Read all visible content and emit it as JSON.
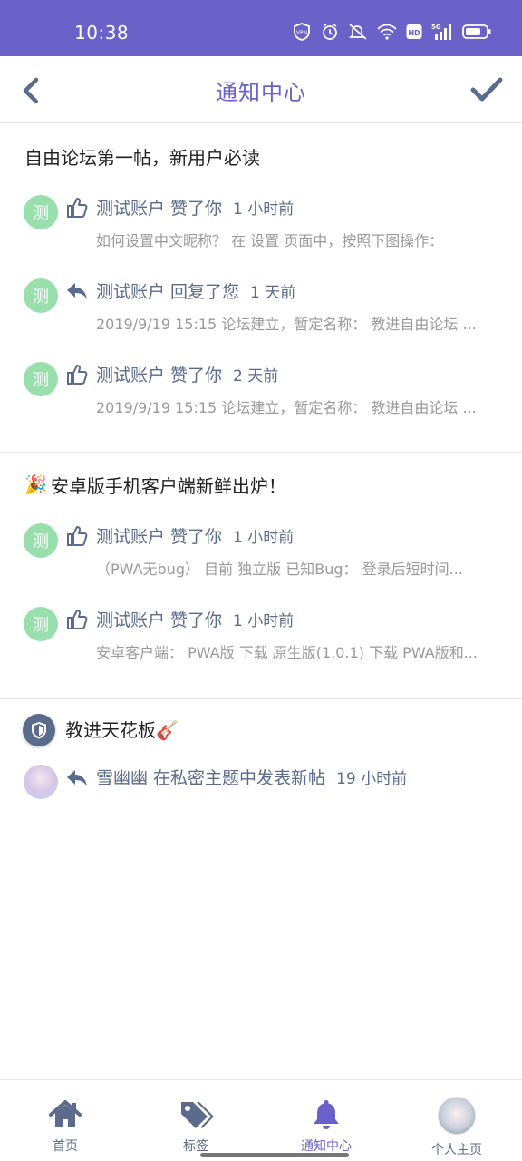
{
  "status_bar": {
    "time": "10:38",
    "icons": [
      "vpn-icon",
      "alarm-icon",
      "mute-icon",
      "wifi-icon",
      "hd-icon",
      "signal-5g-icon",
      "battery-icon"
    ],
    "vpn_text": "VPN",
    "hd_text": "HD",
    "net_text": "5G"
  },
  "header": {
    "title": "通知中心",
    "back_icon": "chevron-left-icon",
    "confirm_icon": "checkmark-icon"
  },
  "groups": [
    {
      "title": "自由论坛第一帖，新用户必读",
      "notifications": [
        {
          "avatar_text": "测",
          "action_icon": "thumbs-up-icon",
          "text": "测试账户 赞了你",
          "time": "1 小时前",
          "excerpt": "如何设置中文昵称？ 在 设置 页面中，按照下图操作："
        },
        {
          "avatar_text": "测",
          "action_icon": "reply-icon",
          "text": "测试账户 回复了您",
          "time": "1 天前",
          "excerpt": "2019/9/19 15:15 论坛建立，暂定名称： 教进自由论坛 ..."
        },
        {
          "avatar_text": "测",
          "action_icon": "thumbs-up-icon",
          "text": "测试账户 赞了你",
          "time": "2 天前",
          "excerpt": "2019/9/19 15:15 论坛建立，暂定名称： 教进自由论坛 ..."
        }
      ]
    },
    {
      "title_emoji": "🎉",
      "title": "安卓版手机客户端新鲜出炉！",
      "notifications": [
        {
          "avatar_text": "测",
          "action_icon": "thumbs-up-icon",
          "text": "测试账户 赞了你",
          "time": "1 小时前",
          "excerpt": "（PWA无bug） 目前 独立版 已知Bug： 登录后短时间..."
        },
        {
          "avatar_text": "测",
          "action_icon": "thumbs-up-icon",
          "text": "测试账户 赞了你",
          "time": "1 小时前",
          "excerpt": "安卓客户端： PWA版 下载 原生版(1.0.1) 下载 PWA版和..."
        }
      ]
    },
    {
      "title_icon": "shield-icon",
      "title": "教进天花板🎸",
      "notifications": [
        {
          "action_icon": "reply-icon",
          "text": "雪幽幽 在私密主题中发表新帖",
          "time": "19 小时前"
        }
      ]
    }
  ],
  "bottom_nav": [
    {
      "label": "首页",
      "icon": "home-icon",
      "active": false
    },
    {
      "label": "标签",
      "icon": "tags-icon",
      "active": false
    },
    {
      "label": "通知中心",
      "icon": "bell-icon",
      "active": true
    },
    {
      "label": "个人主页",
      "icon": "avatar",
      "active": false
    }
  ],
  "colors": {
    "accent": "#6a62c9",
    "secondary": "#5b6b8c",
    "avatar_green": "#98dfad",
    "muted_text": "#9a9a9a"
  }
}
